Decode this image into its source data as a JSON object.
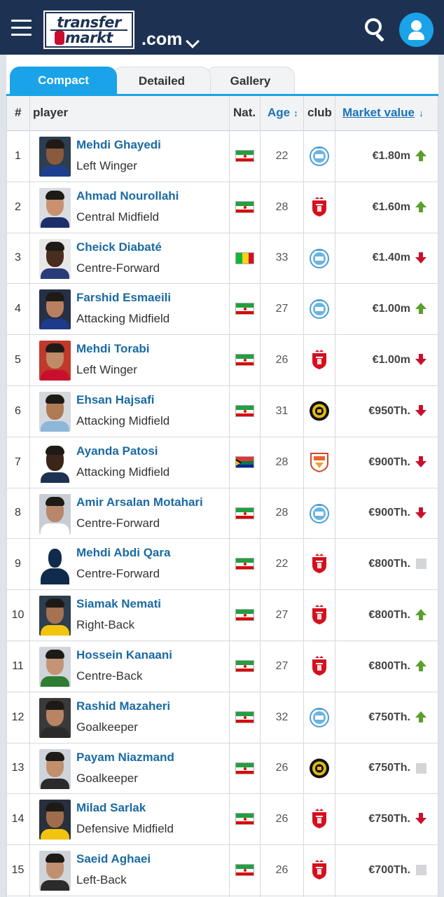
{
  "header": {
    "logo_line1": "transfer",
    "logo_line2": "markt",
    "domain": ".com"
  },
  "tabs": [
    {
      "label": "Compact",
      "active": true
    },
    {
      "label": "Detailed",
      "active": false
    },
    {
      "label": "Gallery",
      "active": false
    }
  ],
  "table": {
    "columns": {
      "num": "#",
      "player": "player",
      "nat": "Nat.",
      "age": "Age",
      "club": "club",
      "value": "Market value"
    },
    "rows": [
      {
        "num": "1",
        "name": "Mehdi Ghayedi",
        "position": "Left Winger",
        "nat": "iran",
        "age": "22",
        "club": "esteghlal",
        "value": "€1.80m",
        "trend": "up"
      },
      {
        "num": "2",
        "name": "Ahmad Nourollahi",
        "position": "Central Midfield",
        "nat": "iran",
        "age": "28",
        "club": "persepolis",
        "value": "€1.60m",
        "trend": "up"
      },
      {
        "num": "3",
        "name": "Cheick Diabaté",
        "position": "Centre-Forward",
        "nat": "mali",
        "age": "33",
        "club": "esteghlal",
        "value": "€1.40m",
        "trend": "down"
      },
      {
        "num": "4",
        "name": "Farshid Esmaeili",
        "position": "Attacking Midfield",
        "nat": "iran",
        "age": "27",
        "club": "esteghlal",
        "value": "€1.00m",
        "trend": "up"
      },
      {
        "num": "5",
        "name": "Mehdi Torabi",
        "position": "Left Winger",
        "nat": "iran",
        "age": "26",
        "club": "persepolis",
        "value": "€1.00m",
        "trend": "down"
      },
      {
        "num": "6",
        "name": "Ehsan Hajsafi",
        "position": "Attacking Midfield",
        "nat": "iran",
        "age": "31",
        "club": "sepahan",
        "value": "€950Th.",
        "trend": "down"
      },
      {
        "num": "7",
        "name": "Ayanda Patosi",
        "position": "Attacking Midfield",
        "nat": "south-africa",
        "age": "28",
        "club": "foolad",
        "value": "€900Th.",
        "trend": "down"
      },
      {
        "num": "8",
        "name": "Amir Arsalan Motahari",
        "position": "Centre-Forward",
        "nat": "iran",
        "age": "28",
        "club": "esteghlal",
        "value": "€900Th.",
        "trend": "down"
      },
      {
        "num": "9",
        "name": "Mehdi Abdi Qara",
        "position": "Centre-Forward",
        "nat": "iran",
        "age": "22",
        "club": "persepolis",
        "value": "€800Th.",
        "trend": "same"
      },
      {
        "num": "10",
        "name": "Siamak Nemati",
        "position": "Right-Back",
        "nat": "iran",
        "age": "27",
        "club": "persepolis",
        "value": "€800Th.",
        "trend": "up"
      },
      {
        "num": "11",
        "name": "Hossein Kanaani",
        "position": "Centre-Back",
        "nat": "iran",
        "age": "27",
        "club": "persepolis",
        "value": "€800Th.",
        "trend": "up"
      },
      {
        "num": "12",
        "name": "Rashid Mazaheri",
        "position": "Goalkeeper",
        "nat": "iran",
        "age": "32",
        "club": "esteghlal",
        "value": "€750Th.",
        "trend": "up"
      },
      {
        "num": "13",
        "name": "Payam Niazmand",
        "position": "Goalkeeper",
        "nat": "iran",
        "age": "26",
        "club": "sepahan",
        "value": "€750Th.",
        "trend": "same"
      },
      {
        "num": "14",
        "name": "Milad Sarlak",
        "position": "Defensive Midfield",
        "nat": "iran",
        "age": "26",
        "club": "persepolis",
        "value": "€750Th.",
        "trend": "down"
      },
      {
        "num": "15",
        "name": "Saeid Aghaei",
        "position": "Left-Back",
        "nat": "iran",
        "age": "26",
        "club": "persepolis",
        "value": "€700Th.",
        "trend": "same"
      }
    ]
  },
  "colors": {
    "header_bg": "#1d3253",
    "accent": "#1aa3e8",
    "link": "#1a6aa3",
    "up": "#5ba02a",
    "down": "#c8102e"
  }
}
